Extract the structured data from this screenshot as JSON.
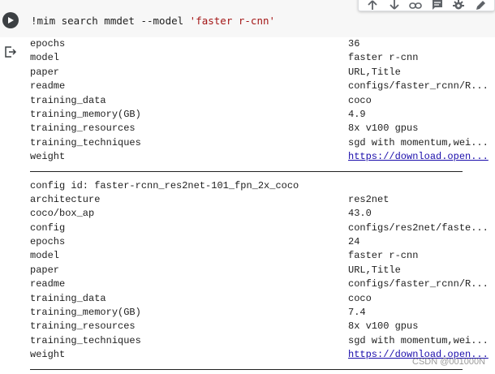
{
  "cell": {
    "command": "!mim search mmdet --model ",
    "query": "'faster r-cnn'",
    "toolbar_icons": [
      "move-up-icon",
      "move-down-icon",
      "link-icon",
      "comment-icon",
      "settings-icon",
      "edit-icon"
    ]
  },
  "output": {
    "block1": [
      {
        "key": "epochs",
        "value": "36"
      },
      {
        "key": "model",
        "value": "faster r-cnn"
      },
      {
        "key": "paper",
        "value": "URL,Title"
      },
      {
        "key": "readme",
        "value": "configs/faster_rcnn/R..."
      },
      {
        "key": "training_data",
        "value": "coco"
      },
      {
        "key": "training_memory(GB)",
        "value": "4.9"
      },
      {
        "key": "training_resources",
        "value": "8x v100 gpus"
      },
      {
        "key": "training_techniques",
        "value": "sgd with momentum,wei..."
      },
      {
        "key": "weight",
        "value": "https://download.open...",
        "link": true
      }
    ],
    "config_id_label": "config id: faster-rcnn_res2net-101_fpn_2x_coco",
    "block2": [
      {
        "key": "architecture",
        "value": "res2net"
      },
      {
        "key": "coco/box_ap",
        "value": "43.0"
      },
      {
        "key": "config",
        "value": "configs/res2net/faste..."
      },
      {
        "key": "epochs",
        "value": "24"
      },
      {
        "key": "model",
        "value": "faster r-cnn"
      },
      {
        "key": "paper",
        "value": "URL,Title"
      },
      {
        "key": "readme",
        "value": "configs/faster_rcnn/R..."
      },
      {
        "key": "training_data",
        "value": "coco"
      },
      {
        "key": "training_memory(GB)",
        "value": "7.4"
      },
      {
        "key": "training_resources",
        "value": "8x v100 gpus"
      },
      {
        "key": "training_techniques",
        "value": "sgd with momentum,wei..."
      },
      {
        "key": "weight",
        "value": "https://download.open...",
        "link": true
      }
    ]
  },
  "watermark": "CSDN @001000N",
  "colors": {
    "cell_bg": "#f7f7f7",
    "string_literal": "#a31515",
    "link": "#1a0dab",
    "run_button": "#3c4043"
  }
}
